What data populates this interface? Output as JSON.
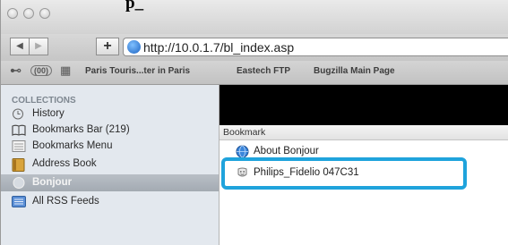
{
  "caption": "p_",
  "toolbar": {
    "back_label": "◀",
    "forward_label": "▶",
    "add_label": "+",
    "url": "http://10.0.1.7/bl_index.asp"
  },
  "bookmarks_bar": {
    "reading_glyph": "⊷",
    "count_glyph": "(00)",
    "grid_glyph": "▦",
    "items": [
      "Paris Touris...ter in Paris",
      "Eastech FTP",
      "Bugzilla Main Page"
    ]
  },
  "sidebar": {
    "heading": "COLLECTIONS",
    "items": [
      {
        "label": "History",
        "icon": "clock-icon"
      },
      {
        "label": "Bookmarks Bar (219)",
        "icon": "book-icon"
      },
      {
        "label": "Bookmarks Menu",
        "icon": "menu-icon"
      },
      {
        "label": "Address Book",
        "icon": "address-book-icon"
      },
      {
        "label": "Bonjour",
        "icon": "bonjour-icon",
        "selected": true
      },
      {
        "label": "All RSS Feeds",
        "icon": "rss-icon"
      }
    ]
  },
  "content": {
    "column_header": "Bookmark",
    "rows": [
      {
        "label": "About Bonjour",
        "icon": "globe-icon"
      },
      {
        "label": "Philips_Fidelio 047C31",
        "icon": "bonjour-device-icon"
      }
    ]
  },
  "colors": {
    "highlight": "#1fa3dc",
    "selection": "#a3aab2",
    "sidebar_bg": "#e3e8ee"
  }
}
